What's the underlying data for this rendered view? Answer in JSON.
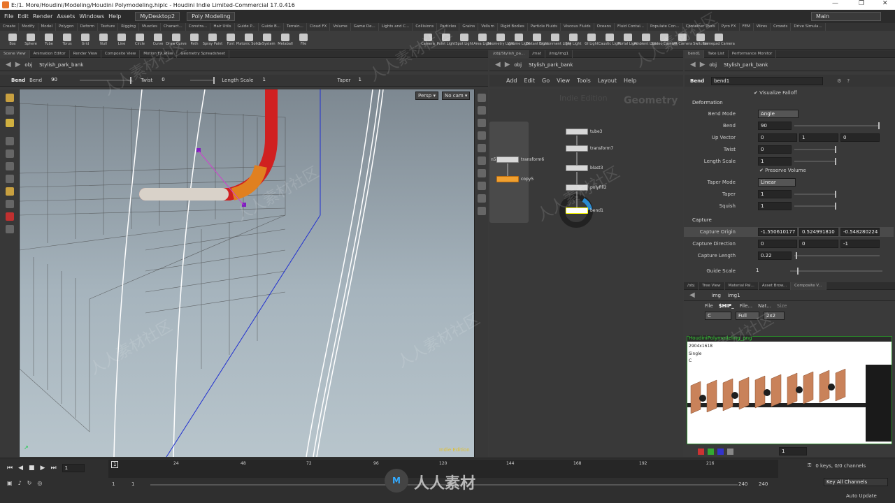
{
  "window": {
    "title": "E:/1. More/Houdini/Modeling/Houdini Polymodeling.hiplc - Houdini Indie Limited-Commercial 17.0.416",
    "min": "—",
    "max": "❐",
    "close": "✕"
  },
  "menu": {
    "items": [
      "File",
      "Edit",
      "Render",
      "Assets",
      "Windows",
      "Help"
    ],
    "desktop": "MyDesktop2",
    "mode": "Poly Modeling",
    "main": "Main"
  },
  "shelf_tabs": [
    "Create",
    "Modify",
    "Model",
    "Polygon",
    "Deform",
    "Texture",
    "Rigging",
    "Muscles",
    "Charact...",
    "Constra...",
    "Hair Utils",
    "Guide P...",
    "Guide B...",
    "Terrain...",
    "Cloud FX",
    "Volume",
    "Game De...",
    "Lights and C...",
    "Collisions",
    "Particles",
    "Grains",
    "Vellum",
    "Rigid Bodies",
    "Particle Fluids",
    "Viscous Fluids",
    "Oceans",
    "Fluid Contai...",
    "Populate Con...",
    "Container Tools",
    "Pyro FX",
    "FEM",
    "Wires",
    "Crowds",
    "Drive Simula..."
  ],
  "shelf_tools_left": [
    "Box",
    "Sphere",
    "Tube",
    "Torus",
    "Grid",
    "Null",
    "Line",
    "Circle",
    "Curve",
    "Draw Curve",
    "Path",
    "Spray Paint",
    "Font",
    "Platonic Solids",
    "L-System",
    "Metaball",
    "File"
  ],
  "shelf_tools_right": [
    "Camera",
    "Point Light",
    "Spot Light",
    "Area Light",
    "Geometry Light",
    "Volume Light",
    "Distant Light",
    "Environment Light",
    "Sky Light",
    "GI Light",
    "Caustic Light",
    "Portal Light",
    "Ambient Light",
    "Stereo Camera",
    "VR Camera",
    "Switcher",
    "Gamepad Camera"
  ],
  "left_tabs": [
    "Scene View",
    "Animation Editor",
    "Render View",
    "Composite View",
    "Motion FX View",
    "Geometry Spreadsheet"
  ],
  "mid_tabs": [
    "/obj/Stylish_pa...",
    "/mat",
    "/img/img1"
  ],
  "right_tabs": [
    "bend1",
    "Take List",
    "Performance Monitor"
  ],
  "path": {
    "obj": "obj",
    "node": "Stylish_park_bank"
  },
  "opbar": {
    "node_type": "Bend",
    "label1": "Bend",
    "bend": "90",
    "twist_label": "Twist",
    "twist": "0",
    "ls_label": "Length Scale",
    "ls": "1",
    "taper_label": "Taper",
    "taper": "1"
  },
  "viewport": {
    "persp": "Persp ▾",
    "cam": "No cam ▾",
    "edition": "Indie Edition"
  },
  "network": {
    "menu": [
      "Add",
      "Edit",
      "Go",
      "View",
      "Tools",
      "Layout",
      "Help"
    ],
    "edition": "Indie Edition",
    "context": "Geometry",
    "nodes": [
      "tube3",
      "transform7",
      "blast3",
      "polyfill2",
      "bend1",
      "transform6",
      "copy5"
    ],
    "n5": "n5"
  },
  "parms": {
    "header_type": "Bend",
    "header_name": "bend1",
    "visualize": "Visualize Falloff",
    "deformation": "Deformation",
    "bend_mode_label": "Bend Mode",
    "bend_mode": "Angle",
    "bend_label": "Bend",
    "bend": "90",
    "upvec_label": "Up Vector",
    "upvec": [
      "0",
      "1",
      "0"
    ],
    "twist_label": "Twist",
    "twist": "0",
    "ls_label": "Length Scale",
    "ls": "1",
    "preserve": "Preserve Volume",
    "taper_mode_label": "Taper Mode",
    "taper_mode": "Linear",
    "taper_label": "Taper",
    "taper": "1",
    "squish_label": "Squish",
    "squish": "1",
    "capture": "Capture",
    "co_label": "Capture Origin",
    "co": [
      "-1.550610177",
      "0.524991810",
      "-0.548280224"
    ],
    "cd_label": "Capture Direction",
    "cd": [
      "0",
      "0",
      "-1"
    ],
    "cl_label": "Capture Length",
    "cl": "0.22",
    "gs_label": "Guide Scale",
    "gs": "1"
  },
  "img_tabs": [
    "/obj",
    "Tree View",
    "Material Pal...",
    "Asset Brow...",
    "Composite V..."
  ],
  "img": {
    "path1": "img",
    "path2": "img1",
    "file": "File",
    "hip": "$HIP_",
    "file2": "File...",
    "nat": "Nat...",
    "size": "Size",
    "c": "C",
    "full": "Full",
    "x2": "2x2",
    "name": "HoudiniPolymodeling_png",
    "res": "2904x1618",
    "single": "Single",
    "chan": "C",
    "frame": "1"
  },
  "timeline": {
    "ticks": [
      "24",
      "48",
      "72",
      "96",
      "120",
      "144",
      "168",
      "192",
      "216"
    ],
    "frame": "1",
    "start": "1",
    "start2": "1",
    "end": "240",
    "end2": "240",
    "keys": "0 keys, 0/0 channels",
    "keyall": "Key All Channels",
    "auto": "Auto Update"
  },
  "watermark": "人人素材社区",
  "brand": "人人素材"
}
